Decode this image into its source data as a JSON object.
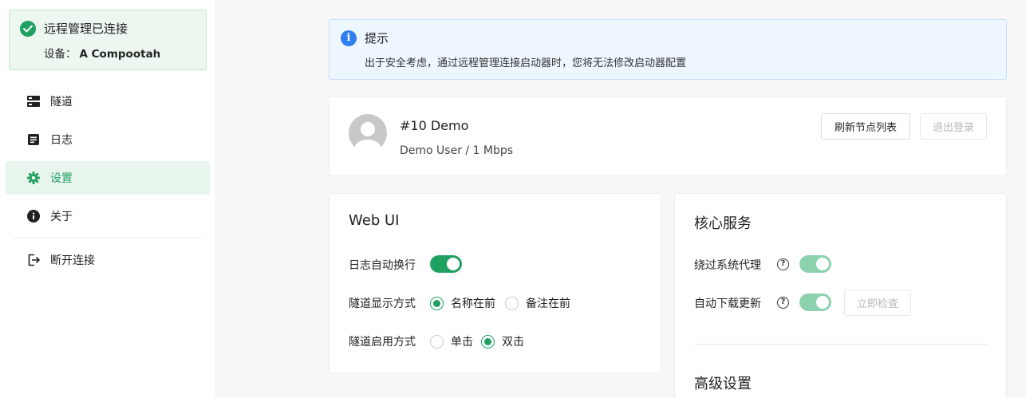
{
  "connection": {
    "status": "远程管理已连接",
    "device_label": "设备：",
    "device_name": "A Compootah"
  },
  "sidebar": {
    "items": [
      {
        "label": "隧道",
        "icon": "server-icon"
      },
      {
        "label": "日志",
        "icon": "log-icon"
      },
      {
        "label": "设置",
        "icon": "gear-icon",
        "active": true
      },
      {
        "label": "关于",
        "icon": "info-icon"
      },
      {
        "label": "断开连接",
        "icon": "logout-icon"
      }
    ]
  },
  "tip": {
    "title": "提示",
    "text": "出于安全考虑，通过远程管理连接启动器时，您将无法修改启动器配置"
  },
  "user": {
    "name": "#10 Demo",
    "subtitle": "Demo User / 1 Mbps",
    "refresh_label": "刷新节点列表",
    "logout_label": "退出登录"
  },
  "webui": {
    "title": "Web UI",
    "auto_wrap_label": "日志自动换行",
    "auto_wrap_on": true,
    "display_label": "隧道显示方式",
    "display_options": [
      "名称在前",
      "备注在前"
    ],
    "display_selected": "名称在前",
    "launch_label": "隧道启用方式",
    "launch_options": [
      "单击",
      "双击"
    ],
    "launch_selected": "双击"
  },
  "core": {
    "title": "核心服务",
    "bypass_proxy_label": "绕过系统代理",
    "bypass_proxy_on": true,
    "auto_update_label": "自动下载更新",
    "auto_update_on": true,
    "check_now_label": "立即检查",
    "advanced_title": "高级设置"
  },
  "colors": {
    "accent": "#20a162",
    "info": "#2f7ff0"
  }
}
